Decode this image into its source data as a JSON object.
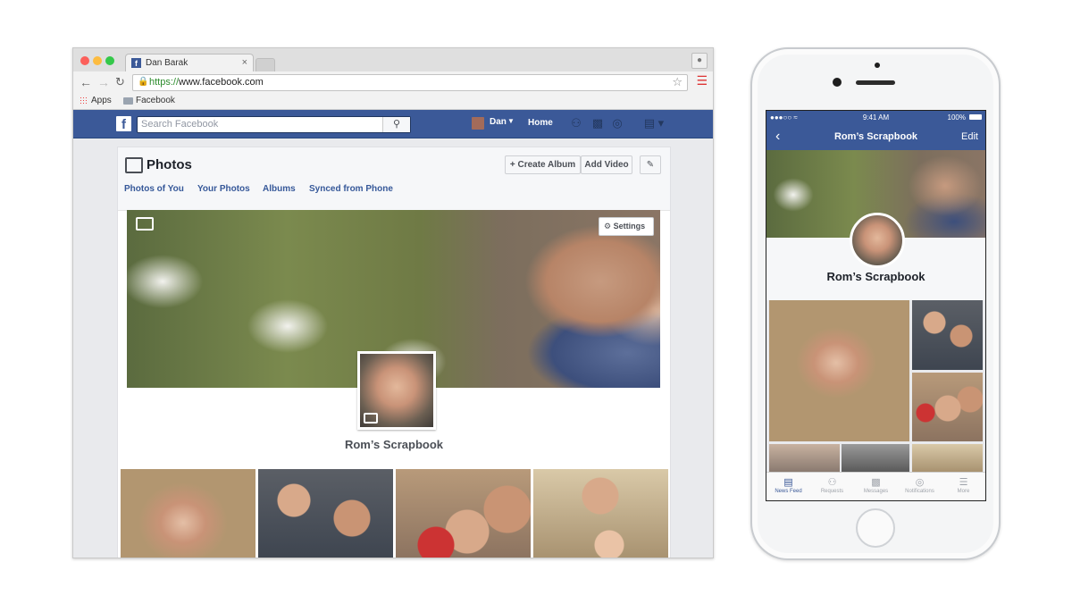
{
  "browser": {
    "tab_title": "Dan Barak",
    "tab_close": "×",
    "url_scheme": "https://",
    "url_host": "www.facebook.com",
    "bookmarks": [
      "Apps",
      "Facebook"
    ]
  },
  "fb_header": {
    "logo": "f",
    "search_placeholder": "Search Facebook",
    "user_name": "Dan",
    "home_label": "Home"
  },
  "photos_page": {
    "title": "Photos",
    "create_album_label": "+ Create Album",
    "add_video_label": "Add Video",
    "tabs": [
      "Photos of You",
      "Your Photos",
      "Albums",
      "Synced from Phone"
    ],
    "settings_label": "Settings",
    "album_title": "Rom’s Scrapbook"
  },
  "phone": {
    "status_time": "9:41 AM",
    "status_battery": "100%",
    "nav_title": "Rom’s Scrapbook",
    "nav_edit": "Edit",
    "album_title": "Rom’s Scrapbook",
    "tabs": [
      "News Feed",
      "Requests",
      "Messages",
      "Notifications",
      "More"
    ]
  },
  "colors": {
    "fb_blue": "#3b5998",
    "link_blue": "#365899"
  }
}
